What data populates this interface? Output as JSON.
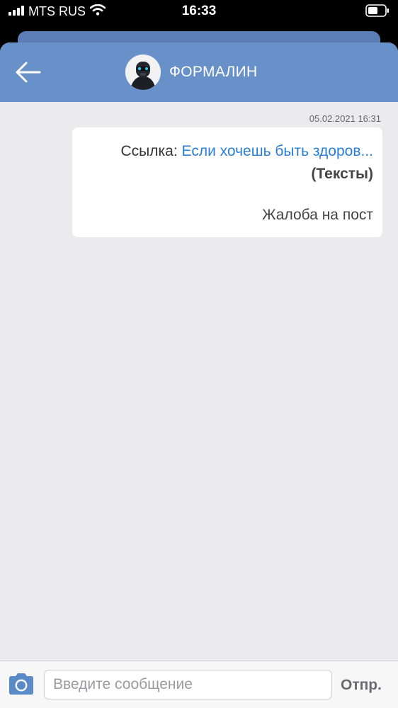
{
  "status_bar": {
    "carrier": "MTS RUS",
    "time": "16:33",
    "icons": [
      "signal-icon",
      "wifi-icon",
      "battery-icon"
    ]
  },
  "header": {
    "title": "ФОРМАЛИН",
    "back_icon": "arrow-left-icon",
    "background_color": "#6891c9"
  },
  "chat": {
    "messages": [
      {
        "timestamp": "05.02.2021 16:31",
        "prefix": "Ссылка:",
        "link_text": "Если хочешь быть здоров...",
        "category": "(Тексты)",
        "report_label": "Жалоба на пост"
      }
    ]
  },
  "composer": {
    "placeholder": "Введите сообщение",
    "value": "",
    "send_label": "Отпр.",
    "camera_icon": "camera-icon"
  },
  "colors": {
    "accent": "#6891c9",
    "link": "#2a7fd4",
    "background": "#ebebee"
  }
}
